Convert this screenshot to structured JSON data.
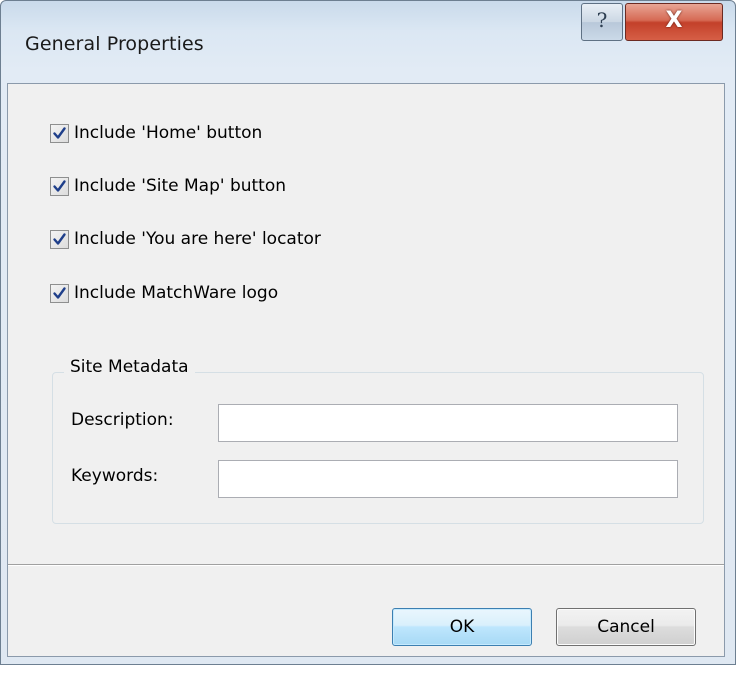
{
  "window": {
    "title": "General Properties",
    "help_glyph": "?",
    "close_glyph": "X"
  },
  "options": [
    {
      "label": "Include 'Home' button",
      "checked": true
    },
    {
      "label": "Include 'Site Map' button",
      "checked": true
    },
    {
      "label": "Include 'You are here' locator",
      "checked": true
    },
    {
      "label": "Include MatchWare logo",
      "checked": true
    }
  ],
  "metadata": {
    "group_title": "Site Metadata",
    "description_label": "Description:",
    "description_value": "",
    "keywords_label": "Keywords:",
    "keywords_value": ""
  },
  "buttons": {
    "ok_label": "OK",
    "cancel_label": "Cancel"
  },
  "icons": {
    "help": "help-icon",
    "close": "close-icon",
    "checkmark": "checkmark-icon"
  },
  "colors": {
    "title_bar": "#dbe7f3",
    "close_button": "#c3402a",
    "checkmark": "#1f3f8a",
    "ok_button_border": "#3c7fb1"
  }
}
